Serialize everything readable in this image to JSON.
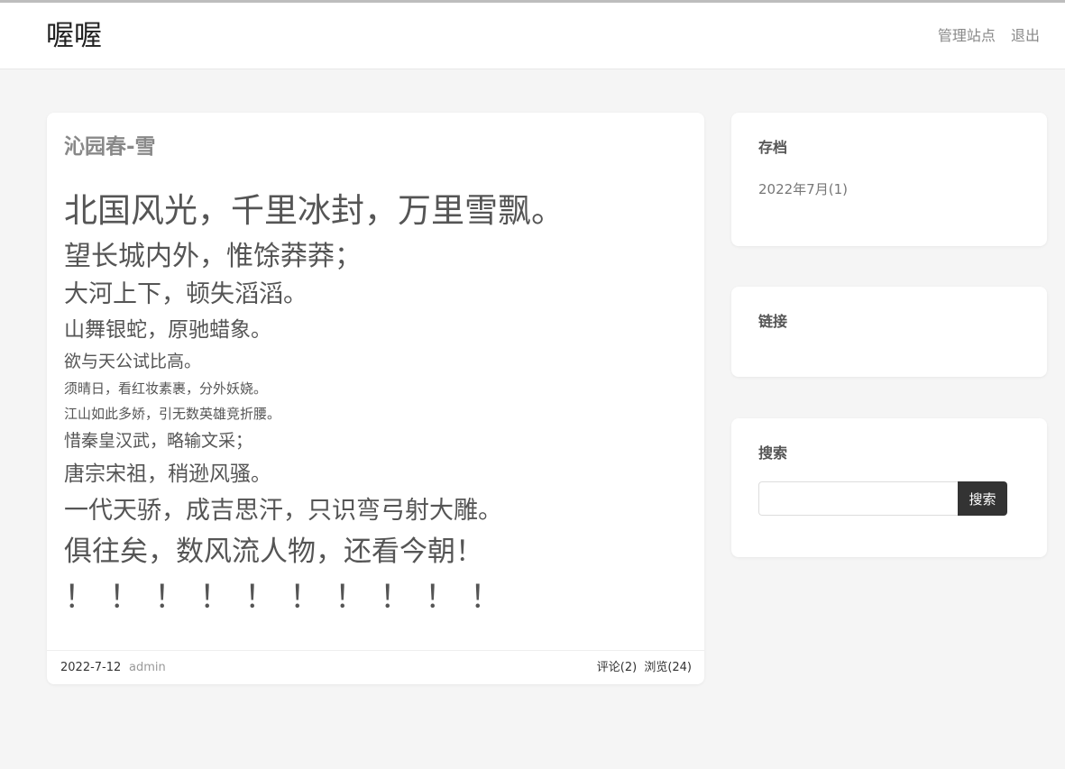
{
  "site": {
    "title": "喔喔"
  },
  "nav": {
    "manage": "管理站点",
    "logout": "退出"
  },
  "post": {
    "title": "沁园春-雪",
    "lines": [
      "北国风光，千里冰封，万里雪飘。",
      "望长城内外，惟馀莽莽；",
      "大河上下，顿失滔滔。",
      "山舞银蛇，原驰蜡象。",
      "欲与天公试比高。",
      "须晴日，看红妆素裹，分外妖娆。",
      "江山如此多娇，引无数英雄竞折腰。",
      "惜秦皇汉武，略输文采；",
      "唐宗宋祖，稍逊风骚。",
      "一代天骄，成吉思汗，只识弯弓射大雕。",
      "俱往矣，数风流人物，还看今朝！",
      "！！！！！！！！！！"
    ],
    "date": "2022-7-12",
    "author": "admin",
    "comments": "评论(2)",
    "views": "浏览(24)"
  },
  "sidebar": {
    "archive": {
      "title": "存档",
      "items": [
        "2022年7月(1)"
      ]
    },
    "links": {
      "title": "链接"
    },
    "search": {
      "title": "搜索",
      "button": "搜索",
      "placeholder": ""
    }
  }
}
